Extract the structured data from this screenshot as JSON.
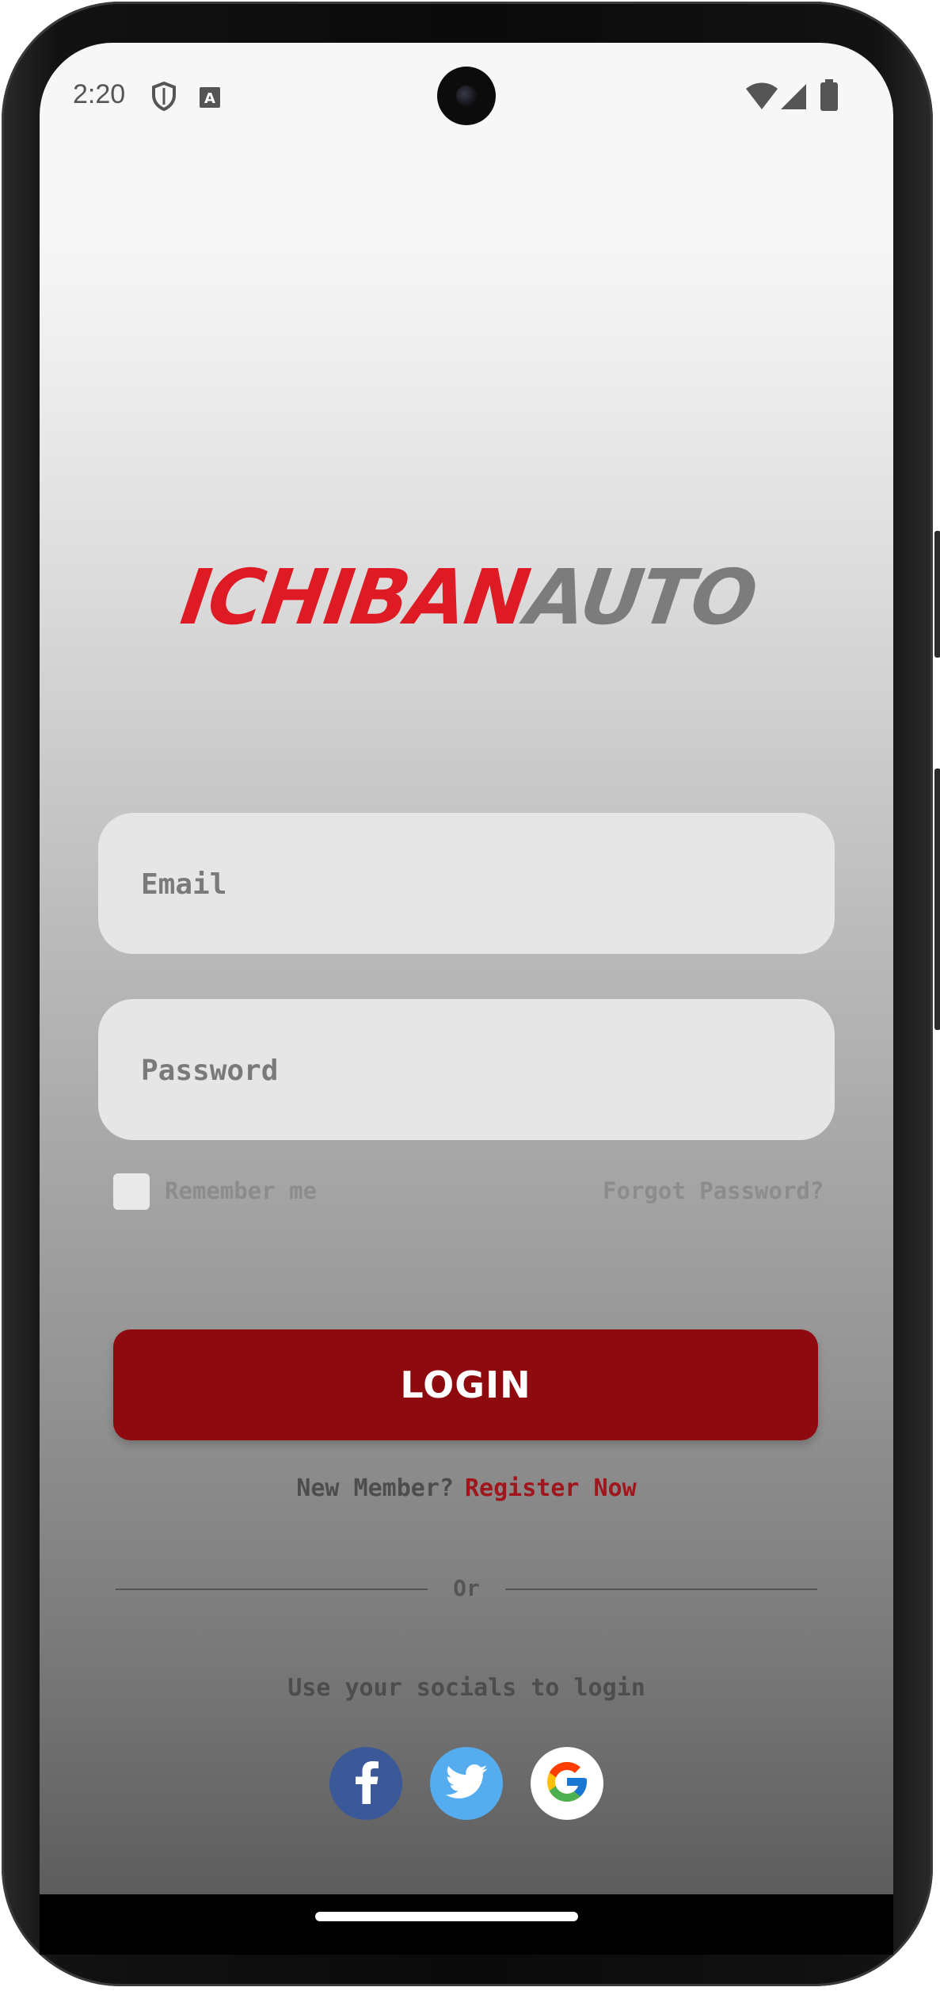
{
  "status_bar": {
    "time": "2:20",
    "icons": [
      "shield-icon",
      "a-badge-icon",
      "wifi-icon",
      "signal-icon",
      "battery-icon"
    ]
  },
  "logo": {
    "part1": "ICHIBAN",
    "part2": "AUTO"
  },
  "form": {
    "email_placeholder": "Email",
    "password_placeholder": "Password",
    "remember_label": "Remember me",
    "forgot_label": "Forgot Password?",
    "login_label": "LOGIN"
  },
  "register": {
    "prompt": "New Member?",
    "link": "Register Now"
  },
  "divider": {
    "label": "Or"
  },
  "socials": {
    "label": "Use your socials to login",
    "buttons": [
      "facebook-icon",
      "twitter-icon",
      "google-icon"
    ]
  },
  "colors": {
    "brand_red": "#de1b24",
    "button_red": "#8e0a0e",
    "link_red": "#a0161c",
    "logo_gray": "#7c7c7c"
  }
}
